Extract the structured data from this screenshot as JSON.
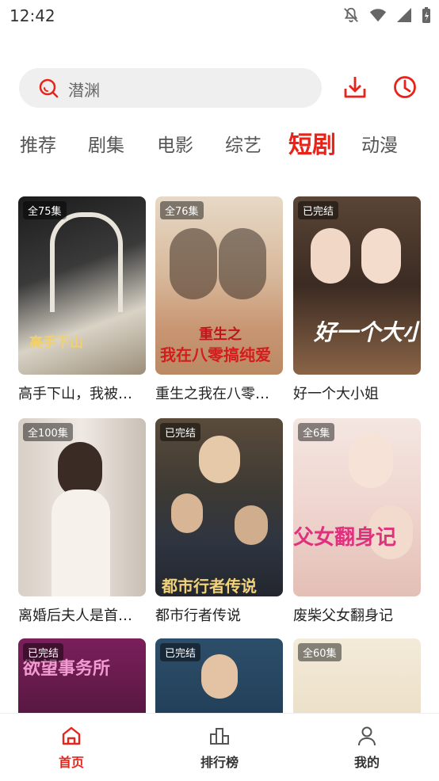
{
  "status": {
    "time": "12:42"
  },
  "search": {
    "placeholder": "潜渊"
  },
  "tabs": [
    {
      "label": "推荐",
      "active": false
    },
    {
      "label": "剧集",
      "active": false
    },
    {
      "label": "电影",
      "active": false
    },
    {
      "label": "综艺",
      "active": false
    },
    {
      "label": "短剧",
      "active": true
    },
    {
      "label": "动漫",
      "active": false
    }
  ],
  "cards": [
    {
      "badge": "全75集",
      "title": "高手下山，我被…",
      "overlay": "高手下山"
    },
    {
      "badge": "全76集",
      "title": "重生之我在八零…",
      "overlay": "我在八零搞纯爱",
      "overlay2": "重生之"
    },
    {
      "badge": "已完结",
      "title": "好一个大小姐",
      "overlay": "好一个大小姐"
    },
    {
      "badge": "全100集",
      "title": "离婚后夫人是首…"
    },
    {
      "badge": "已完结",
      "title": "都市行者传说",
      "overlay": "都市行者传说"
    },
    {
      "badge": "全6集",
      "title": "废柴父女翻身记",
      "overlay": "父女翻身记"
    },
    {
      "badge": "已完结",
      "title": "",
      "overlay": "欲望事务所"
    },
    {
      "badge": "已完结",
      "title": ""
    },
    {
      "badge": "全60集",
      "title": ""
    }
  ],
  "nav": [
    {
      "label": "首页",
      "active": true
    },
    {
      "label": "排行榜",
      "active": false
    },
    {
      "label": "我的",
      "active": false
    }
  ],
  "colors": {
    "accent": "#e8231a",
    "search_bg": "#efefef"
  }
}
